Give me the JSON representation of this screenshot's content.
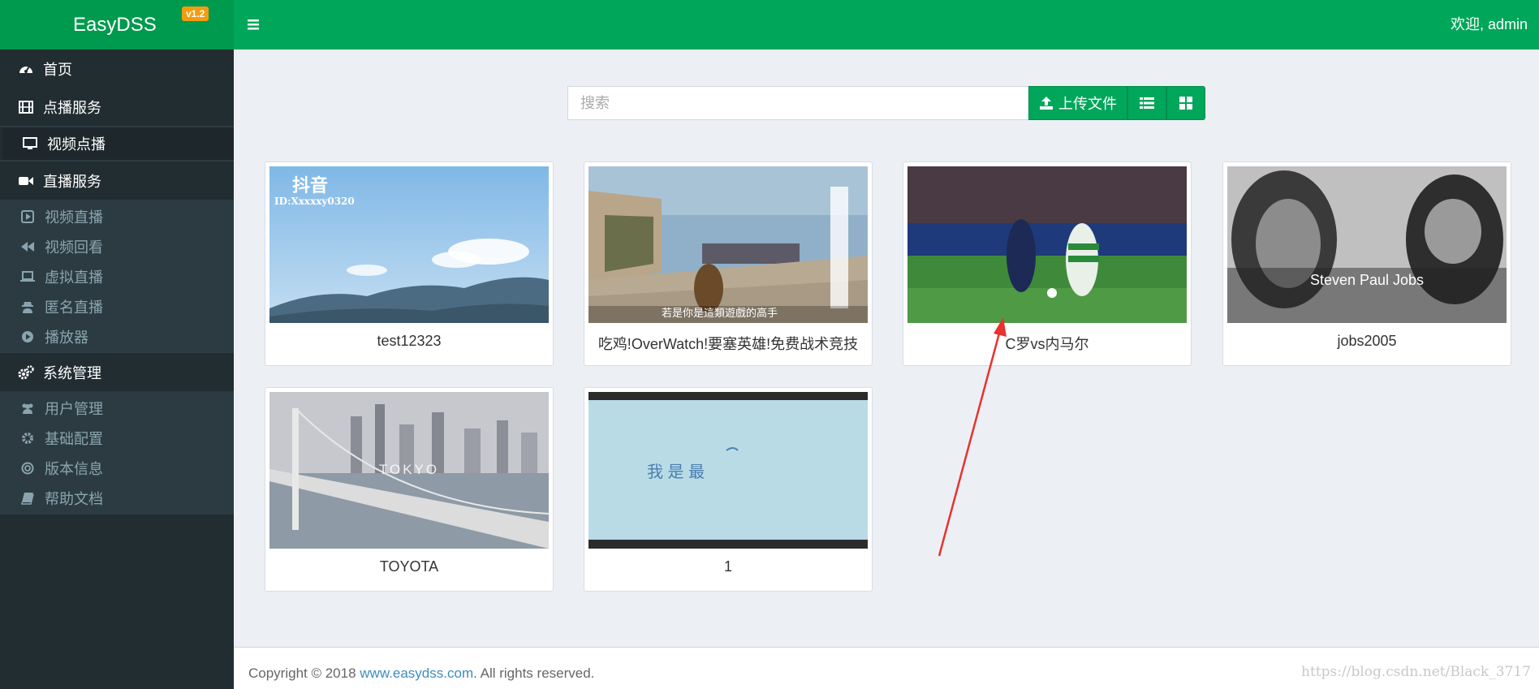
{
  "app": {
    "name": "EasyDSS",
    "version": "v1.2"
  },
  "header": {
    "welcome": "欢迎, admin"
  },
  "sidebar": {
    "home": "首页",
    "vod_service": "点播服务",
    "vod_items": [
      {
        "label": "视频点播",
        "icon": "monitor-icon"
      }
    ],
    "live_service": "直播服务",
    "live_items": [
      {
        "label": "视频直播",
        "icon": "play-square-icon"
      },
      {
        "label": "视频回看",
        "icon": "backward-icon"
      },
      {
        "label": "虚拟直播",
        "icon": "laptop-icon"
      },
      {
        "label": "匿名直播",
        "icon": "user-secret-icon"
      },
      {
        "label": "播放器",
        "icon": "play-circle-icon"
      }
    ],
    "system": "系统管理",
    "system_items": [
      {
        "label": "用户管理",
        "icon": "users-icon"
      },
      {
        "label": "基础配置",
        "icon": "gear-icon"
      },
      {
        "label": "版本信息",
        "icon": "globe-icon"
      },
      {
        "label": "帮助文档",
        "icon": "book-icon"
      }
    ]
  },
  "toolbar": {
    "search_placeholder": "搜索",
    "upload_label": "上传文件"
  },
  "videos": [
    {
      "title": "test12323",
      "overlay": "抖音",
      "overlay_sub": "ID:Xxxxxy0320"
    },
    {
      "title": "吃鸡!OverWatch!要塞英雄!免费战术竞技",
      "overlay": "若是你是這類遊戲的高手"
    },
    {
      "title": "C罗vs内马尔"
    },
    {
      "title": "jobs2005",
      "overlay": "Steven Paul Jobs"
    },
    {
      "title": "TOYOTA",
      "overlay": "TOKYO"
    },
    {
      "title": "1",
      "overlay": "我 是 最"
    }
  ],
  "footer": {
    "copyright_prefix": "Copyright © 2018 ",
    "link": "www.easydss.com",
    "suffix": ". All rights reserved.",
    "watermark": "https://blog.csdn.net/Black_3717"
  },
  "colors": {
    "brand": "#00a65a",
    "sidebar": "#222d32",
    "annotation_arrow": "#e8322f"
  }
}
